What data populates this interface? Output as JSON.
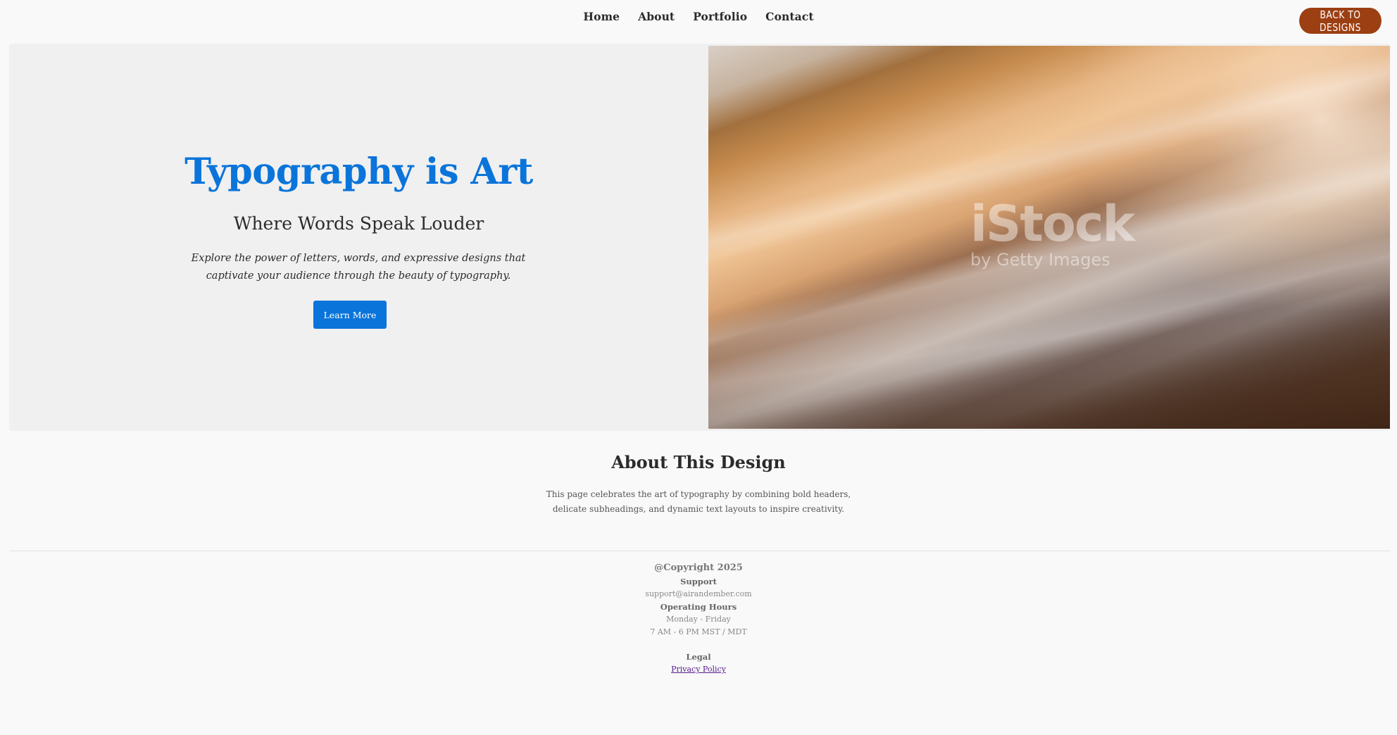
{
  "nav": {
    "links": [
      "Home",
      "About",
      "Portfolio",
      "Contact"
    ],
    "back_label": "Back to Designs"
  },
  "hero": {
    "title": "Typography is Art",
    "subtitle": "Where Words Speak Louder",
    "description": "Explore the power of letters, words, and expressive designs that captivate your audience through the beauty of typography.",
    "button_label": "Learn More",
    "image": {
      "watermark_main": "iStock",
      "watermark_sub": "by Getty Images"
    }
  },
  "about": {
    "title": "About This Design",
    "text": "This page celebrates the art of typography by combining bold headers, delicate subheadings, and dynamic text layouts to inspire creativity."
  },
  "footer": {
    "copyright": "@Copyright 2025",
    "support_heading": "Support",
    "support_email": "support@airandember.com",
    "hours_heading": "Operating Hours",
    "hours_days": "Monday - Friday",
    "hours_time": "7 AM - 6 PM MST / MDT",
    "legal_heading": "Legal",
    "privacy_label": "Privacy Policy"
  },
  "colors": {
    "accent": "#0a74da",
    "back_button": "#9c3f12",
    "background": "#f9f9f9",
    "hero_panel": "#f0f0f0"
  }
}
